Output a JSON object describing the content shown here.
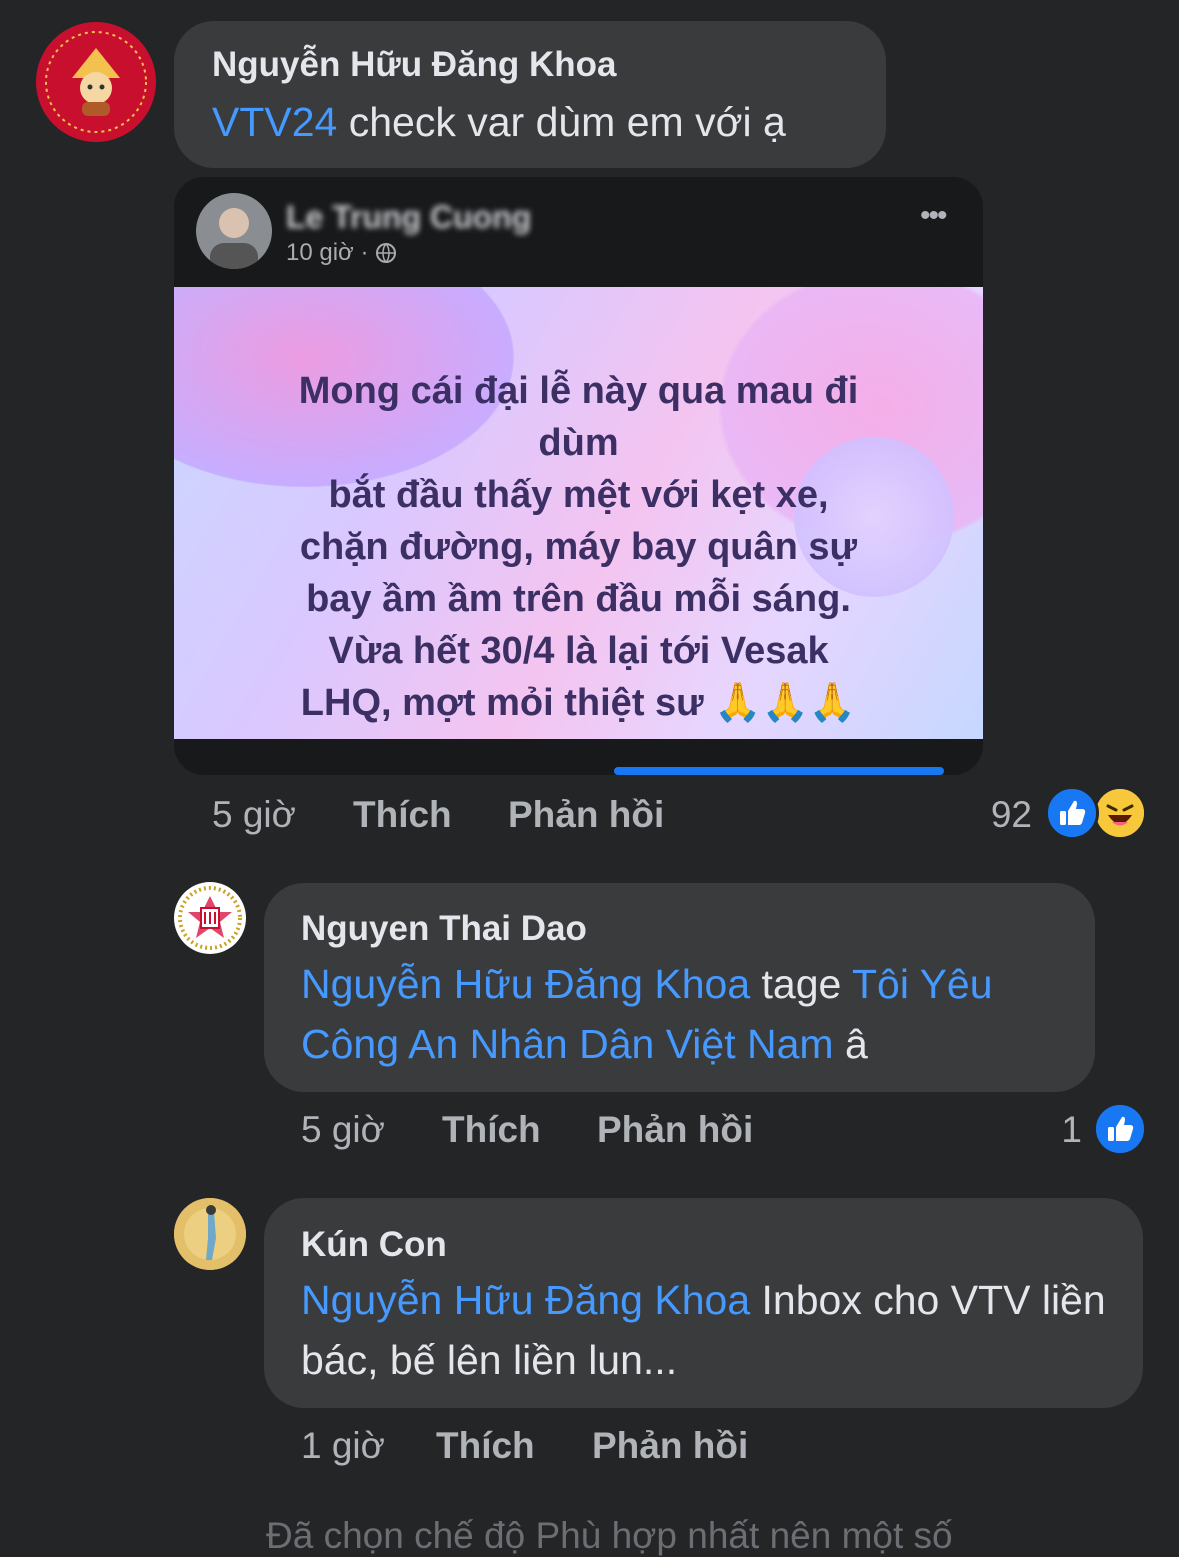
{
  "comments": [
    {
      "author": "Nguyễn Hữu Đăng Khoa",
      "mention": "VTV24",
      "text": " check var dùm em với ạ",
      "time": "5 giờ",
      "like_label": "Thích",
      "reply_label": "Phản hồi",
      "reaction_count": "92"
    },
    {
      "author": "Nguyen Thai Dao",
      "mention_1": "Nguyễn Hữu Đăng Khoa",
      "text_1": " tage ",
      "mention_2": "Tôi Yêu Công An Nhân Dân Việt Nam",
      "text_2": " â",
      "time": "5 giờ",
      "like_label": "Thích",
      "reply_label": "Phản hồi",
      "reaction_count": "1"
    },
    {
      "author": "Kún Con",
      "mention": "Nguyễn Hữu Đăng Khoa",
      "text": " Inbox cho VTV liền bác, bế lên liền lun...",
      "time": "1 giờ",
      "like_label": "Thích",
      "reply_label": "Phản hồi"
    }
  ],
  "embedded_post": {
    "author": "Le Trung Cuong",
    "time": "10 giờ",
    "quote_lines": [
      "Mong cái đại lễ này qua mau đi",
      "dùm",
      "bắt đầu thấy mệt với kẹt xe,",
      "chặn đường, máy bay quân sự",
      "bay ầm ầm trên đầu mỗi sáng.",
      "Vừa hết 30/4 là lại tới Vesak",
      "LHQ, mợt mỏi thiệt sư 🙏🙏🙏"
    ]
  },
  "footer_partial": "Đã chọn chế độ Phù hợp nhất nên một số",
  "colors": {
    "background": "#242526",
    "bubble": "#3a3b3c",
    "mention": "#4599ff",
    "muted": "#b0b3b8"
  },
  "icons": [
    "more-options-icon",
    "globe-icon",
    "like-reaction-icon",
    "haha-reaction-icon"
  ]
}
